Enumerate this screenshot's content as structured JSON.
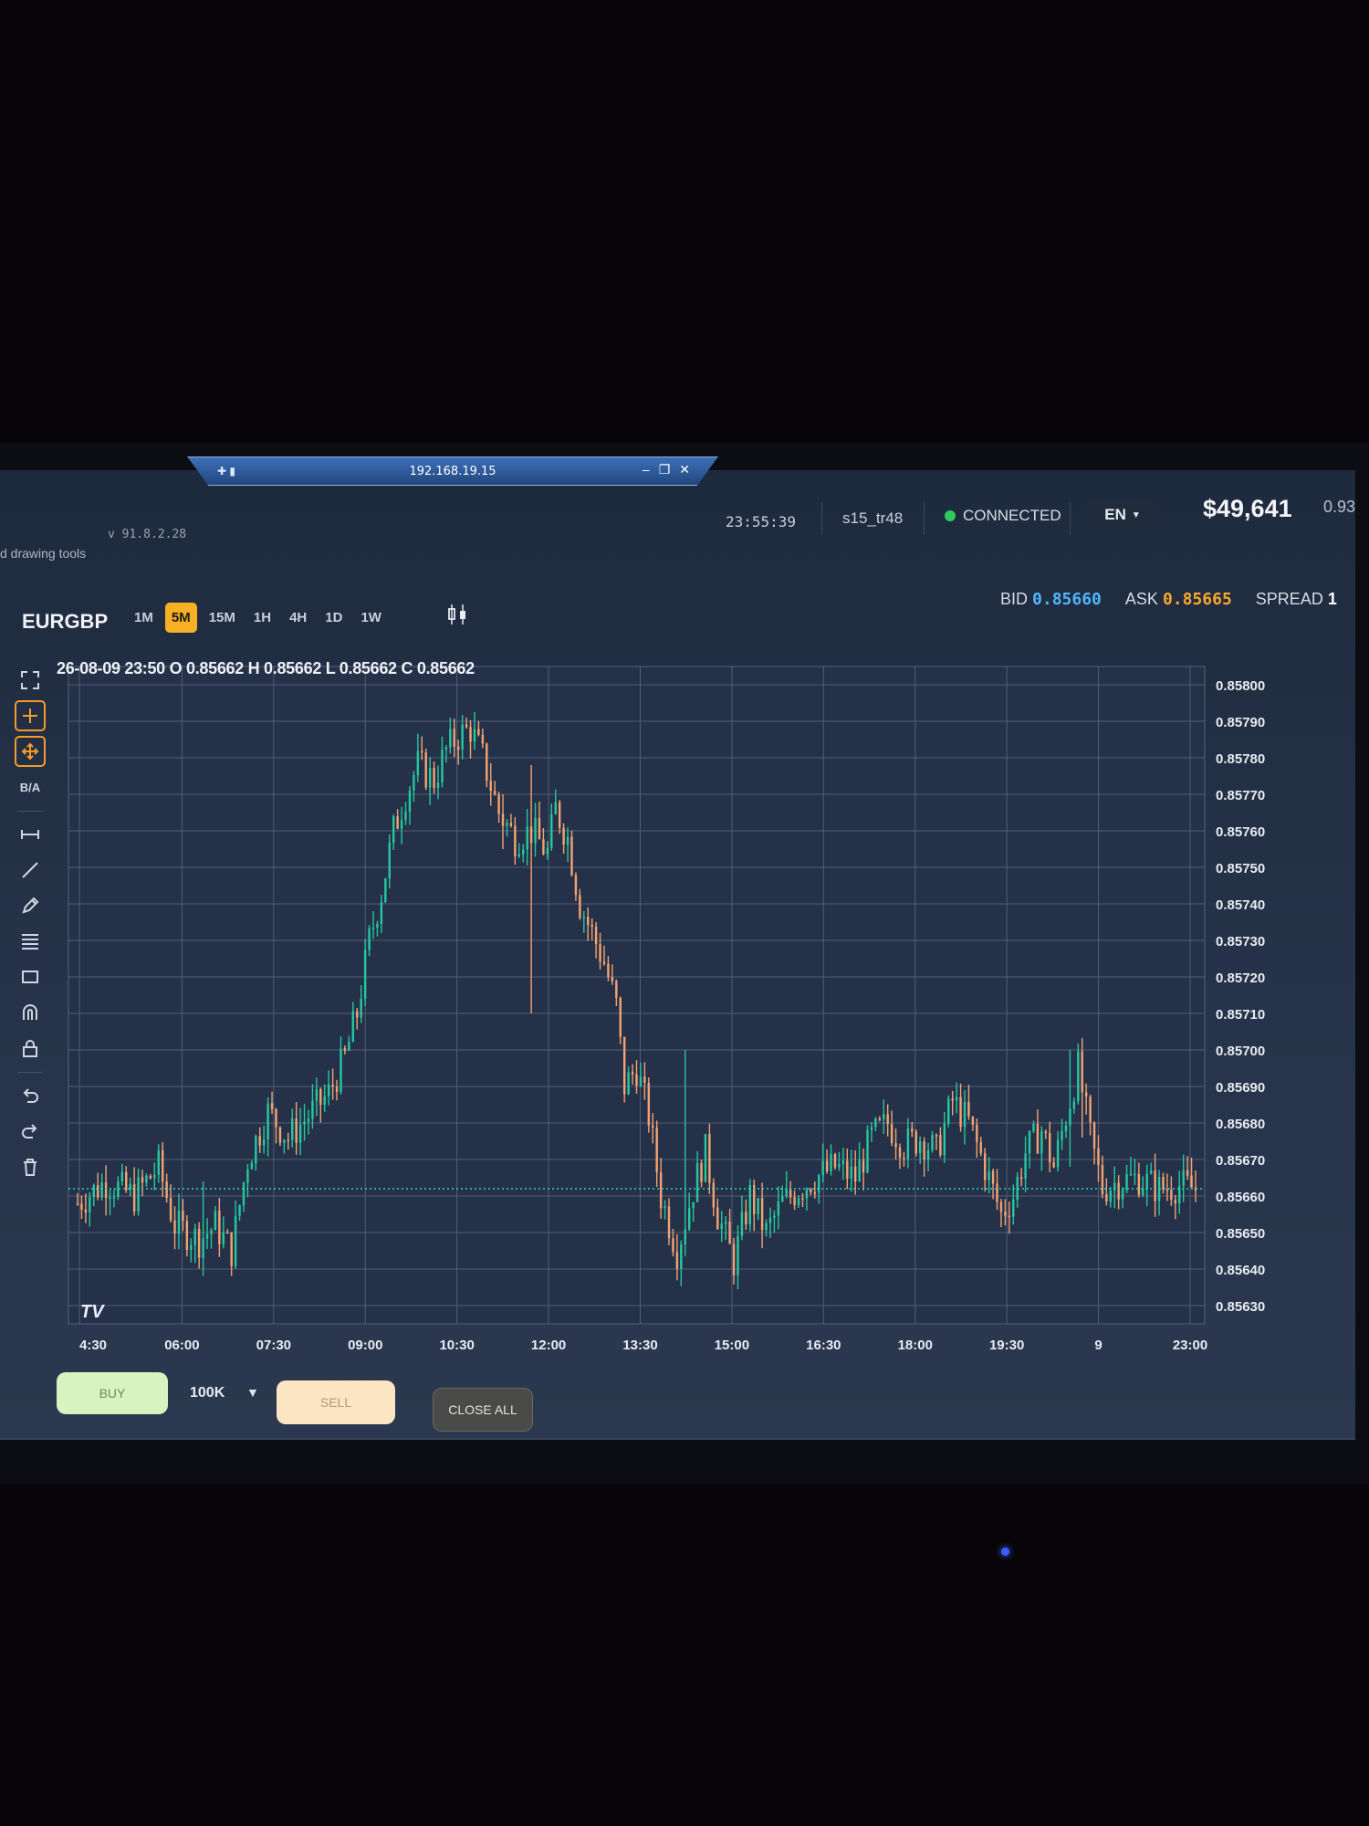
{
  "remote_bar": {
    "ip": "192.168.19.15",
    "pin_icon": "pin-icon",
    "signal_icon": "signal-icon",
    "minimize": "–",
    "restore": "❐",
    "close": "✕"
  },
  "header": {
    "version": "v 91.8.2.28",
    "subtitle": "d drawing tools",
    "clock": "23:55:39",
    "user": "s15_tr48",
    "connection_status": "CONNECTED",
    "language": "EN",
    "balance": "$49,641",
    "margin": "0.93"
  },
  "toolbar": {
    "symbol": "EURGBP",
    "timeframes": [
      "1M",
      "5M",
      "15M",
      "1H",
      "4H",
      "1D",
      "1W"
    ],
    "active_timeframe": "5M",
    "chart_type_icon": "candlestick-icon",
    "bid_label": "BID",
    "bid_value": "0.85660",
    "ask_label": "ASK",
    "ask_value": "0.85665",
    "spread_label": "SPREAD",
    "spread_value": "1"
  },
  "tools": {
    "ba_label": "B/A",
    "items": [
      "fullscreen-icon",
      "crosshair-icon",
      "move-icon",
      "ba-toggle",
      "horizontal-line-icon",
      "trend-line-icon",
      "pencil-icon",
      "fib-levels-icon",
      "rectangle-icon",
      "magnet-icon",
      "lock-icon",
      "undo-icon",
      "redo-icon",
      "trash-icon"
    ]
  },
  "ohlc_line": "26-08-09 23:50 O 0.85662 H 0.85662 L 0.85662 C 0.85662",
  "tv_logo": "TV",
  "trade_bar": {
    "buy_label": "BUY",
    "quantity": "100K",
    "sell_label": "SELL",
    "close_all_label": "CLOSE ALL"
  },
  "colors": {
    "up": "#26c6a0",
    "down": "#f2a272",
    "accent": "#f7b023",
    "bid": "#4fb6ff",
    "ask": "#f7a82c",
    "current_price_line": "#2fd6b8"
  },
  "chart_data": {
    "type": "candlestick",
    "symbol": "EURGBP",
    "timeframe": "5M",
    "y_ticks": [
      "0.85800",
      "0.85790",
      "0.85780",
      "0.85770",
      "0.85760",
      "0.85750",
      "0.85740",
      "0.85730",
      "0.85720",
      "0.85710",
      "0.85700",
      "0.85690",
      "0.85680",
      "0.85670",
      "0.85660",
      "0.85650",
      "0.85640",
      "0.85630"
    ],
    "ylim": [
      0.85625,
      0.85805
    ],
    "x_ticks": [
      "4:30",
      "06:00",
      "07:30",
      "09:00",
      "10:30",
      "12:00",
      "13:30",
      "15:00",
      "16:30",
      "18:00",
      "19:30",
      "9",
      "23:00"
    ],
    "current_price": 0.85662,
    "path": [
      [
        0,
        0.85658
      ],
      [
        7,
        0.85664
      ],
      [
        14,
        0.8566
      ],
      [
        20,
        0.85668
      ],
      [
        24,
        0.85652
      ],
      [
        30,
        0.85648
      ],
      [
        34,
        0.85652
      ],
      [
        38,
        0.85645
      ],
      [
        42,
        0.8567
      ],
      [
        47,
        0.85683
      ],
      [
        52,
        0.85676
      ],
      [
        57,
        0.85682
      ],
      [
        62,
        0.85688
      ],
      [
        66,
        0.85698
      ],
      [
        69,
        0.8571
      ],
      [
        72,
        0.8573
      ],
      [
        75,
        0.85743
      ],
      [
        78,
        0.8576
      ],
      [
        81,
        0.8577
      ],
      [
        84,
        0.85778
      ],
      [
        88,
        0.85774
      ],
      [
        91,
        0.85782
      ],
      [
        94,
        0.85786
      ],
      [
        97,
        0.85788
      ],
      [
        100,
        0.8578
      ],
      [
        104,
        0.85765
      ],
      [
        108,
        0.85758
      ],
      [
        112,
        0.8576
      ],
      [
        116,
        0.85754
      ],
      [
        118,
        0.85766
      ],
      [
        121,
        0.85758
      ],
      [
        124,
        0.8574
      ],
      [
        127,
        0.85732
      ],
      [
        130,
        0.85724
      ],
      [
        133,
        0.85712
      ],
      [
        135,
        0.8569
      ],
      [
        138,
        0.85695
      ],
      [
        141,
        0.85682
      ],
      [
        144,
        0.8566
      ],
      [
        148,
        0.85645
      ],
      [
        152,
        0.85662
      ],
      [
        155,
        0.85672
      ],
      [
        158,
        0.85655
      ],
      [
        162,
        0.85642
      ],
      [
        166,
        0.8566
      ],
      [
        170,
        0.8565
      ],
      [
        174,
        0.85658
      ],
      [
        178,
        0.85662
      ],
      [
        182,
        0.85665
      ],
      [
        187,
        0.85668
      ],
      [
        192,
        0.85665
      ],
      [
        196,
        0.85676
      ],
      [
        200,
        0.8568
      ],
      [
        204,
        0.85674
      ],
      [
        208,
        0.85676
      ],
      [
        212,
        0.85672
      ],
      [
        216,
        0.85686
      ],
      [
        220,
        0.8568
      ],
      [
        224,
        0.85668
      ],
      [
        228,
        0.85655
      ],
      [
        231,
        0.8566
      ],
      [
        234,
        0.85672
      ],
      [
        238,
        0.85678
      ],
      [
        241,
        0.85668
      ],
      [
        244,
        0.85682
      ],
      [
        247,
        0.85695
      ],
      [
        250,
        0.85676
      ],
      [
        253,
        0.85662
      ],
      [
        257,
        0.85664
      ],
      [
        262,
        0.85665
      ],
      [
        267,
        0.85662
      ],
      [
        272,
        0.85663
      ],
      [
        276,
        0.85662
      ]
    ],
    "spikes": [
      [
        150,
        0.857,
        0.85648
      ],
      [
        105,
        0.8577,
        0.85755
      ],
      [
        112,
        0.85778,
        0.8571
      ],
      [
        245,
        0.857,
        0.85668
      ],
      [
        248,
        0.85703,
        0.85676
      ],
      [
        31,
        0.85664,
        0.8564
      ]
    ]
  }
}
